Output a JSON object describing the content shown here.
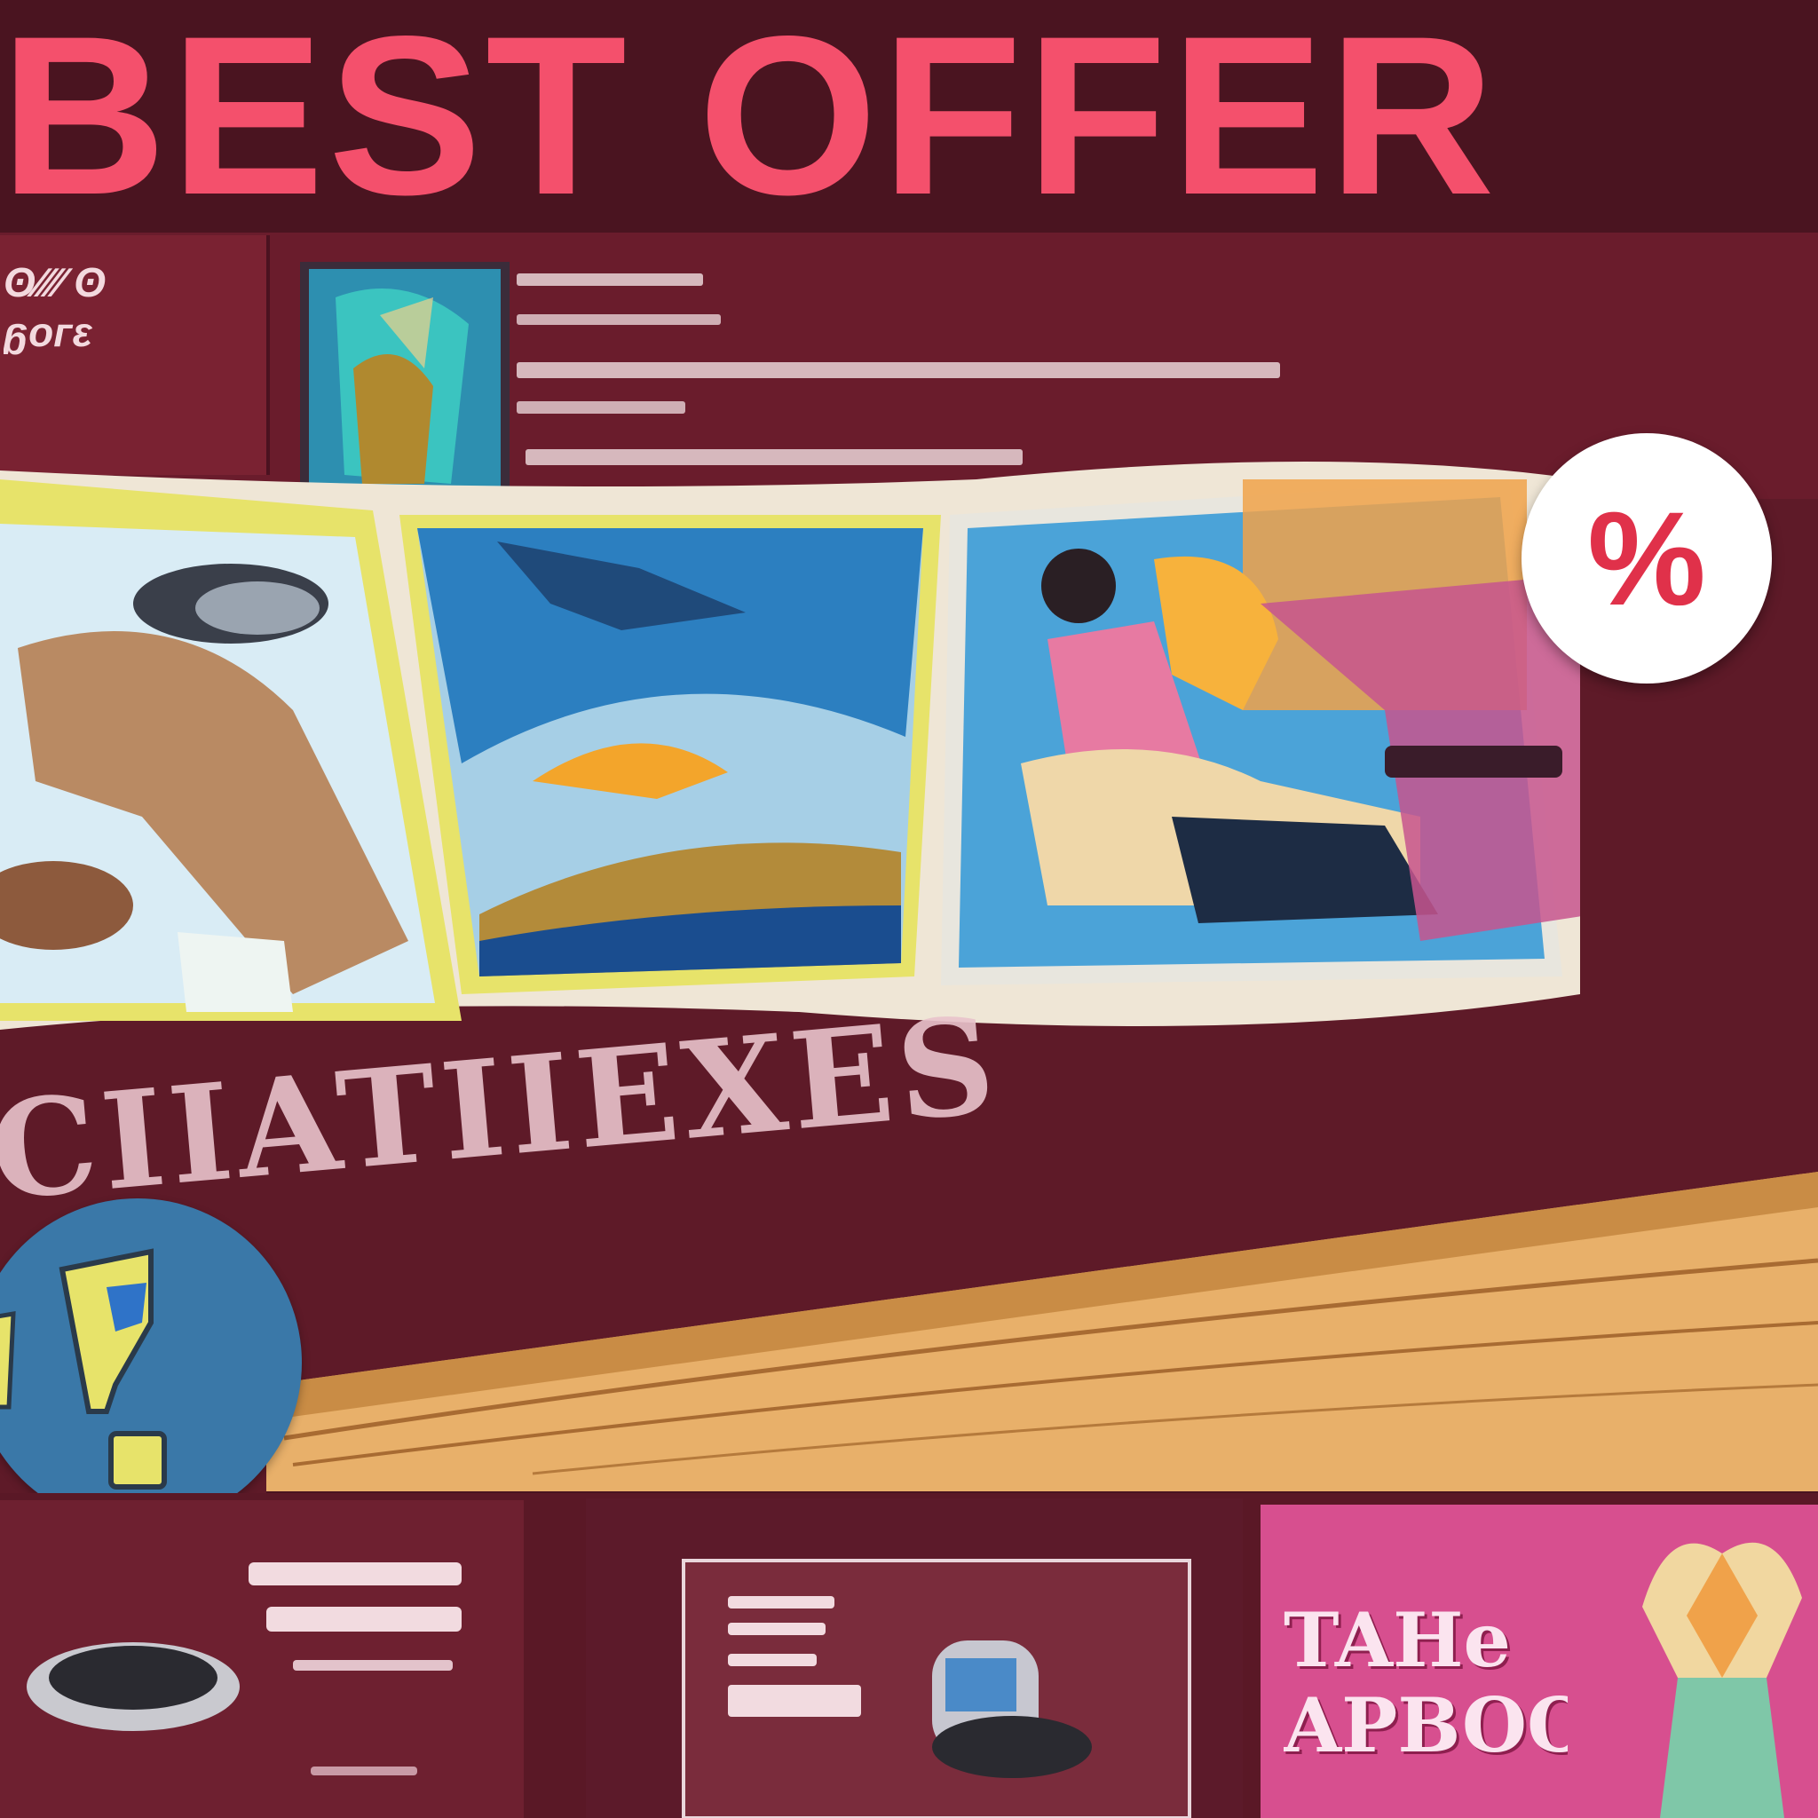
{
  "headline": {
    "text": "BEST OFFER",
    "color": "#f4506c"
  },
  "discount_badge": {
    "symbol": "%",
    "icon": "percent-icon"
  },
  "alert_badge": {
    "icon": "exclamation-icon"
  },
  "corner_badge": {
    "text": "ʘ∕∕∕∕ ʘ\nᵷᴏᴦɛ"
  },
  "banner_word": {
    "text": "CIIATIIEXES"
  },
  "pink_sign": {
    "text": "TAHe\nAPBOO"
  },
  "colors": {
    "background": "#5e1a28",
    "accent": "#f4506c",
    "shelf": "#e8b06a",
    "frame": "#e7e36a",
    "badge_blue": "#3a78a8",
    "pink_panel": "#d74f8f"
  }
}
